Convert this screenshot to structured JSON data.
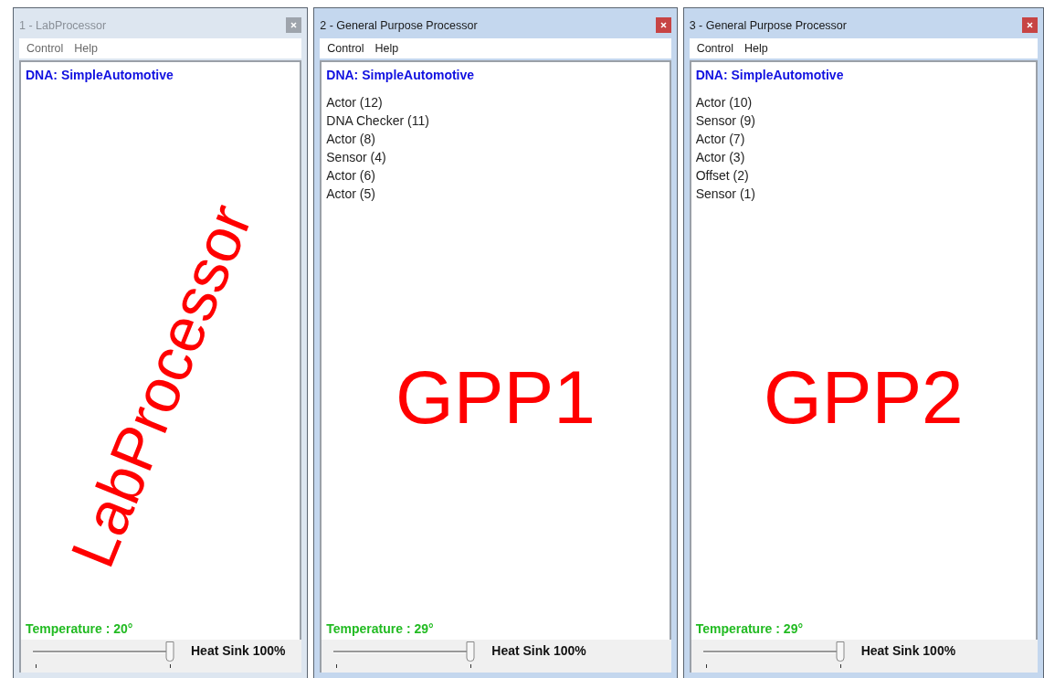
{
  "windows": [
    {
      "title": "1 - LabProcessor",
      "active": false,
      "menu": [
        "Control",
        "Help"
      ],
      "dna": "DNA: SimpleAutomotive",
      "overlay_label": {
        "text": "LabProcessor",
        "rotated": true
      },
      "temperature": "Temperature : 20°",
      "heat_sink": {
        "label": "Heat Sink 100%",
        "level": 1
      }
    },
    {
      "title": "2 - General Purpose Processor",
      "active": true,
      "menu": [
        "Control",
        "Help"
      ],
      "dna": "DNA: SimpleAutomotive",
      "modules": [
        "Actor (12)",
        "DNA Checker (11)",
        "Actor (8)",
        "Sensor (4)",
        "Actor (6)",
        "Actor (5)"
      ],
      "overlay_label": {
        "text": "GPP1",
        "rotated": false
      },
      "temperature": "Temperature : 29°",
      "heat_sink": {
        "label": "Heat Sink 100%",
        "level": 1
      }
    },
    {
      "title": "3 - General Purpose Processor",
      "active": true,
      "menu": [
        "Control",
        "Help"
      ],
      "dna": "DNA: SimpleAutomotive",
      "modules": [
        "Actor (10)",
        "Sensor (9)",
        "Actor (7)",
        "Actor (3)",
        "Offset (2)",
        "Sensor (1)"
      ],
      "overlay_label": {
        "text": "GPP2",
        "rotated": false
      },
      "temperature": "Temperature : 29°",
      "heat_sink": {
        "label": "Heat Sink 100%",
        "level": 1
      }
    }
  ]
}
